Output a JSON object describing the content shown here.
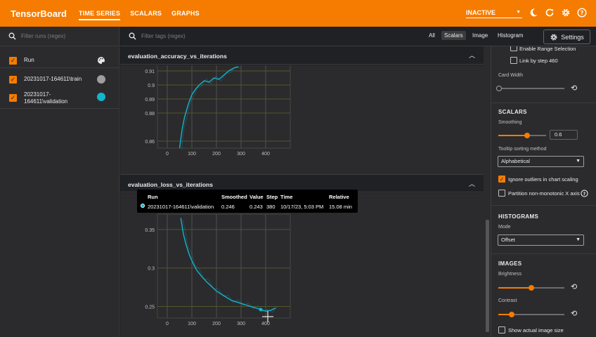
{
  "app": {
    "title": "TensorBoard",
    "tabs": [
      {
        "label": "TIME SERIES",
        "active": true
      },
      {
        "label": "SCALARS",
        "active": false
      },
      {
        "label": "GRAPHS",
        "active": false
      }
    ],
    "status": "INACTIVE",
    "accent_color": "#f57c00"
  },
  "runs_pane": {
    "filter_placeholder": "Filter runs (regex)",
    "header_label": "Run",
    "runs": [
      {
        "name": "20231017-164611\\train",
        "color": "#9e9e9e",
        "checked": true
      },
      {
        "name_line1": "20231017-",
        "name_line2": "164611\\validation",
        "color": "#12b5cb",
        "checked": true
      }
    ]
  },
  "toolbar": {
    "filter_placeholder": "Filter tags (regex)",
    "type_tabs": [
      "All",
      "Scalars",
      "Image",
      "Histogram"
    ],
    "active_type": "Scalars",
    "settings_label": "Settings"
  },
  "cards": [
    {
      "title": "evaluation_accuracy_vs_iterations",
      "chart_data": {
        "type": "line",
        "x_ticks": [
          "0",
          "100",
          "200",
          "300",
          "400"
        ],
        "y_ticks": [
          "0.86",
          "0.88",
          "0.89",
          "0.9",
          "0.91"
        ],
        "xlim": [
          -40,
          500
        ],
        "ylim": [
          0.855,
          0.915
        ],
        "series": [
          {
            "name": "20231017-164611\\validation",
            "color": "#12b5cb",
            "x": [
              50,
              60,
              70,
              85,
              100,
              115,
              130,
              150,
              170,
              190,
              210,
              230,
              250,
              270,
              290
            ],
            "y": [
              0.855,
              0.868,
              0.877,
              0.886,
              0.893,
              0.897,
              0.9,
              0.903,
              0.902,
              0.905,
              0.904,
              0.907,
              0.91,
              0.912,
              0.913
            ]
          }
        ]
      }
    },
    {
      "title": "evaluation_loss_vs_iterations",
      "chart_data": {
        "type": "line",
        "x_ticks": [
          "0",
          "100",
          "200",
          "300",
          "400"
        ],
        "y_ticks": [
          "0.25",
          "0.3",
          "0.35"
        ],
        "xlim": [
          -40,
          500
        ],
        "ylim": [
          0.235,
          0.37
        ],
        "series": [
          {
            "name": "20231017-164611\\validation",
            "color": "#12b5cb",
            "x": [
              55,
              65,
              75,
              90,
              105,
              120,
              140,
              160,
              180,
              200,
              220,
              240,
              260,
              280,
              300,
              320,
              340,
              360,
              380,
              400,
              420,
              440
            ],
            "y": [
              0.365,
              0.345,
              0.332,
              0.317,
              0.306,
              0.297,
              0.289,
              0.282,
              0.276,
              0.27,
              0.266,
              0.262,
              0.258,
              0.256,
              0.254,
              0.252,
              0.25,
              0.248,
              0.246,
              0.244,
              0.245,
              0.248
            ]
          }
        ]
      }
    }
  ],
  "tooltip": {
    "headers": [
      "Run",
      "Smoothed",
      "Value",
      "Step",
      "Time",
      "Relative"
    ],
    "row": {
      "run": "20231017-164611\\validation",
      "smoothed": "0.246",
      "value": "0.243",
      "step": "380",
      "time": "10/17/23, 5:03 PM",
      "relative": "15.08 min",
      "color": "#12b5cb"
    }
  },
  "settings_pane": {
    "enable_range_selection": "Enable Range Selection",
    "link_by_step": "Link by step 460",
    "card_width_label": "Card Width",
    "scalars_title": "SCALARS",
    "smoothing_label": "Smoothing",
    "smoothing_value": "0.6",
    "smoothing_fraction": 0.6,
    "tooltip_sort_label": "Tooltip sorting method",
    "tooltip_sort_value": "Alphabetical",
    "ignore_outliers": "Ignore outliers in chart scaling",
    "partition_label": "Partition non-monotonic X axis",
    "histograms_title": "HISTOGRAMS",
    "mode_label": "Mode",
    "mode_value": "Offset",
    "images_title": "IMAGES",
    "brightness_label": "Brightness",
    "brightness_fraction": 0.5,
    "contrast_label": "Contrast",
    "contrast_fraction": 0.2,
    "show_actual_size": "Show actual image size"
  }
}
